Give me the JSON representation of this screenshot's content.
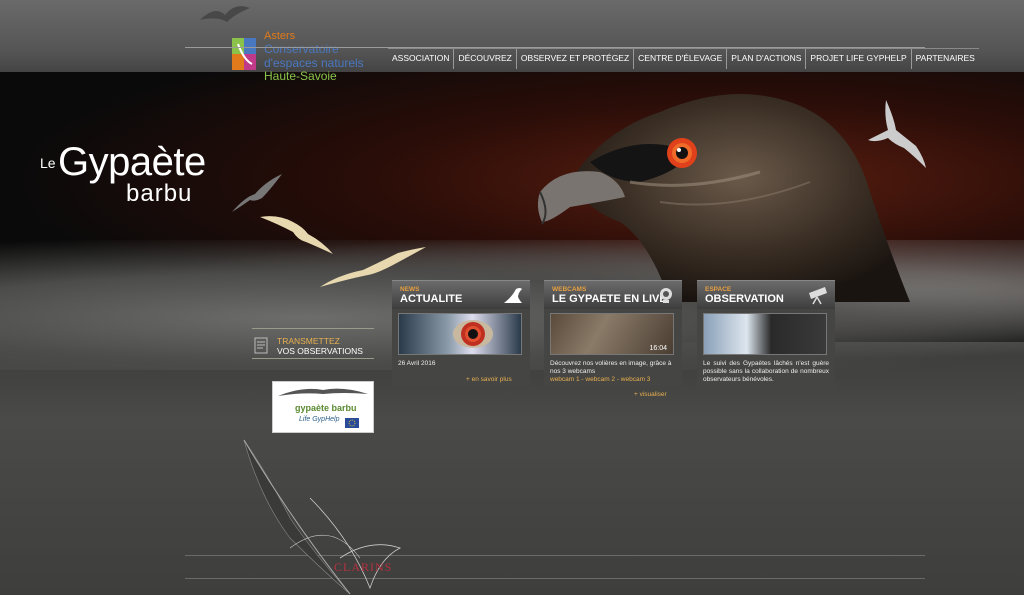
{
  "logo": {
    "line1": "Asters",
    "line2": "Conservatoire",
    "line3": "d'espaces naturels",
    "line4": "Haute-Savoie"
  },
  "nav": {
    "items": [
      {
        "label": "ASSOCIATION"
      },
      {
        "label": "DÉCOUVREZ"
      },
      {
        "label": "OBSERVEZ ET PROTÉGEZ"
      },
      {
        "label": "CENTRE D'ÉLEVAGE"
      },
      {
        "label": "PLAN D'ACTIONS"
      },
      {
        "label": "PROJET LIFE GYPHELP"
      },
      {
        "label": "PARTENAIRES"
      }
    ]
  },
  "hero": {
    "title_le": "Le",
    "title_main": "Gypaète",
    "title_sub": "barbu"
  },
  "cards": [
    {
      "kicker": "NEWS",
      "title": "ACTUALITE",
      "icon": "bird-icon",
      "date": "26 Avril 2016",
      "more": "+ en savoir plus"
    },
    {
      "kicker": "WEBCAMS",
      "title": "LE GYPAETE EN LIVE",
      "icon": "webcam-icon",
      "timestamp": "16:04",
      "text": "Découvrez nos volières en image, grâce à nos 3 webcams",
      "links": "webcam 1 - webcam 2 - webcam 3",
      "more": "+ visualiser"
    },
    {
      "kicker": "ESPACE",
      "title": "OBSERVATION",
      "icon": "telescope-icon",
      "text": "Le suivi des Gypaètes lâchés n'est guère possible sans la collaboration de nombreux observateurs bénévoles."
    }
  ],
  "transmit": {
    "line1": "TRANSMETTEZ",
    "line2": "VOS OBSERVATIONS"
  },
  "banner": {
    "line1": "gypaète barbu",
    "line2": "Life GypHelp"
  },
  "footer": {
    "sponsor": "CLARINS"
  }
}
